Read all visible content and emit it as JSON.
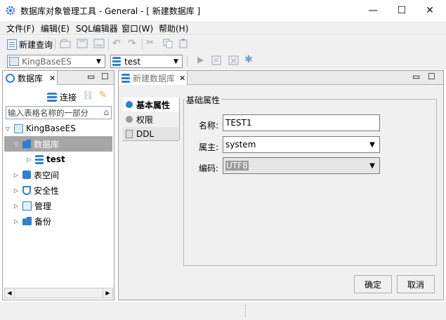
{
  "window": {
    "title": "数据库对象管理工具 - General - [ 新建数据库 ]",
    "minimize_glyph": "—",
    "maximize_glyph": "☐",
    "close_glyph": "✕"
  },
  "menu": [
    {
      "label": "文件(F)"
    },
    {
      "label": "编辑(E)"
    },
    {
      "label": "SQL编辑器"
    },
    {
      "label": "窗口(W)"
    },
    {
      "label": "帮助(H)"
    }
  ],
  "toolbar": {
    "new_query_label": "新建查询",
    "server_combo_value": "KingBaseES",
    "db_combo_value": "test"
  },
  "left_panel": {
    "tab_label": "数据库",
    "tab_close": "✕",
    "connect_label": "连接",
    "filter_placeholder": "输入表格名称的一部分",
    "tree": {
      "root": "KingBaseES",
      "databases": "数据库",
      "test": "test",
      "tablespace": "表空间",
      "security": "安全性",
      "manage": "管理",
      "backup": "备份"
    }
  },
  "right_panel": {
    "tab_label": "新建数据库",
    "tab_close": "✕",
    "vtabs": [
      "基本属性",
      "权限",
      "DDL"
    ],
    "group_title": "基础属性",
    "name_label": "名称:",
    "name_value": "TEST1",
    "owner_label": "属主:",
    "owner_value": "system",
    "encoding_label": "编码:",
    "encoding_value": "UTF8",
    "ok_label": "确定",
    "cancel_label": "取消"
  },
  "colors": {
    "accent": "#1e7ad6",
    "selection": "#a3a3a3",
    "panel_bg": "#f0f0f0"
  },
  "icons": [
    "gear-icon",
    "new-query-icon",
    "database-icon",
    "server-icon",
    "link-icon",
    "tree-expand-icon"
  ]
}
